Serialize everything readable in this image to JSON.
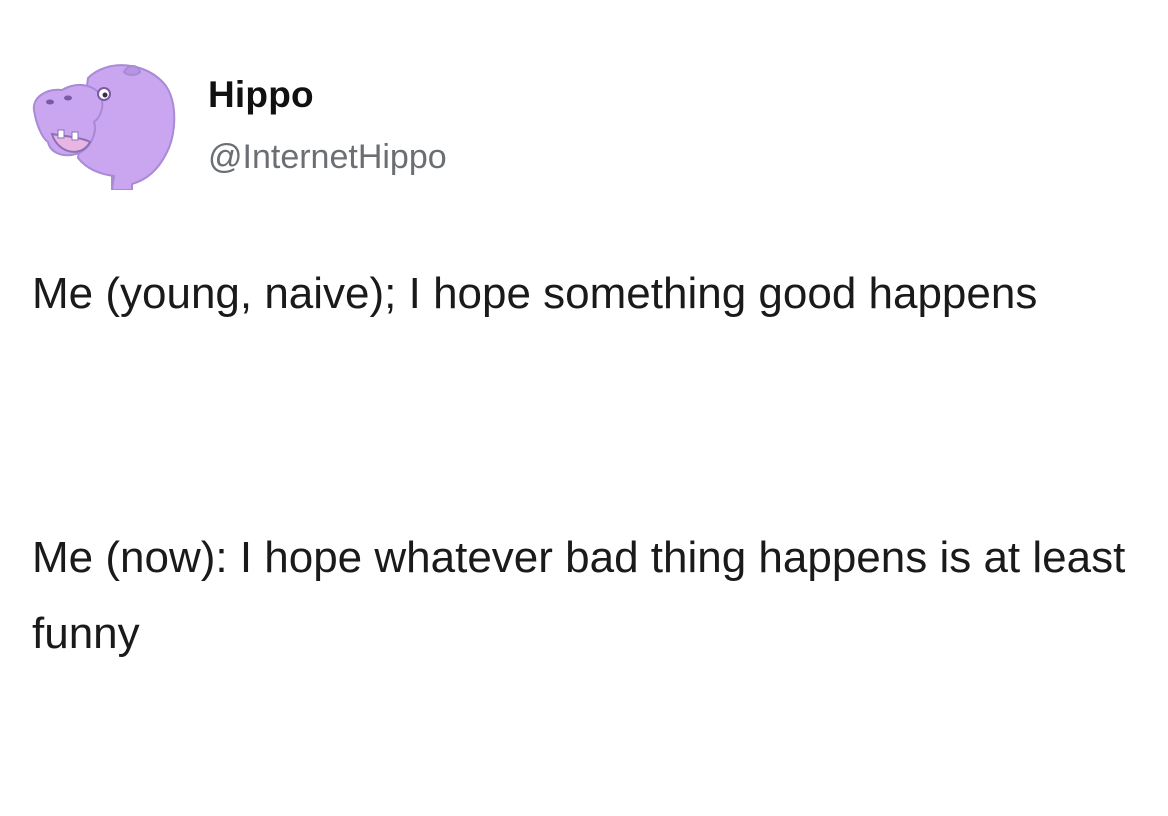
{
  "author": {
    "display_name": "Hippo",
    "handle": "@InternetHippo",
    "avatar_icon": "purple-hippo-avatar",
    "avatar_color": "#c9a6ef"
  },
  "tweet": {
    "paragraphs": [
      "Me (young, naive); I hope something good happens",
      "Me (now): I hope whatever bad thing happens is at least funny"
    ]
  },
  "colors": {
    "background": "#ffffff",
    "text": "#1a1a1a",
    "handle": "#6b6f74"
  }
}
